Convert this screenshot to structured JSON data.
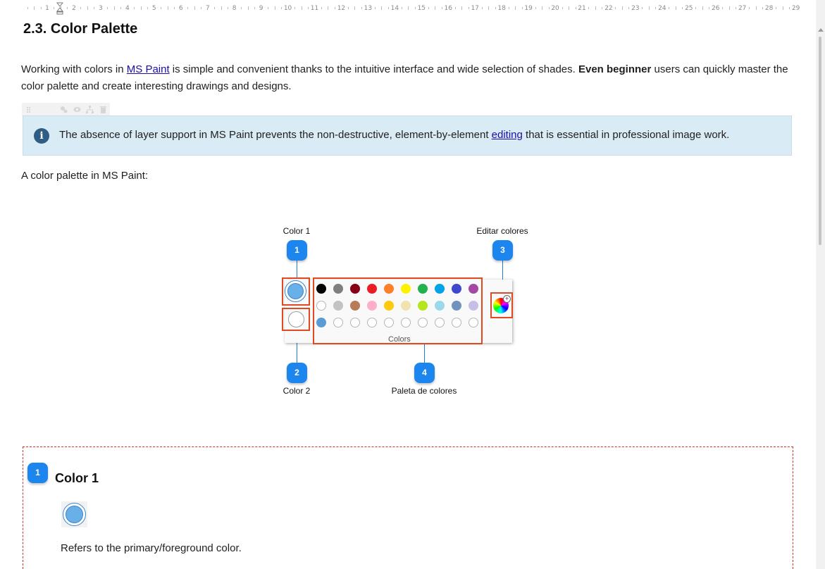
{
  "ruler": {
    "numbers": [
      "1",
      "2",
      "3",
      "4",
      "5",
      "6",
      "7",
      "8",
      "9",
      "10",
      "11",
      "12",
      "13",
      "14",
      "15",
      "16",
      "17",
      "18",
      "19",
      "20",
      "21",
      "22",
      "23",
      "24",
      "25",
      "26",
      "27",
      "28",
      "29"
    ]
  },
  "section": {
    "heading": "2.3. Color Palette",
    "intro_before_link": "Working with colors in ",
    "intro_link": "MS Paint",
    "intro_mid": " is simple and convenient thanks to the intuitive interface and wide selection of shades. ",
    "intro_bold": "Even beginner",
    "intro_after": " users can quickly master the color palette and create interesting drawings and designs."
  },
  "toolbar_icons": [
    "drag-handle-icon",
    "settings-icon",
    "visibility-icon",
    "hierarchy-icon",
    "delete-icon"
  ],
  "note": {
    "icon": "info-icon",
    "text_before_link": "The absence of layer support in MS Paint prevents the non-destructive, element-by-element ",
    "link": "editing",
    "text_after": " that is essential in professional image work."
  },
  "caption": "A color palette in MS Paint:",
  "figure": {
    "labels": {
      "color1": "Color 1",
      "color2": "Color 2",
      "edit_colors": "Editar colores",
      "palette": "Paleta de colores"
    },
    "badges": [
      "1",
      "2",
      "3",
      "4"
    ],
    "colors_label": "Colors",
    "row1": [
      "#000000",
      "#7f7f7f",
      "#880015",
      "#ed1c24",
      "#ff7f27",
      "#fff200",
      "#22b14c",
      "#00a2e8",
      "#3f48cc",
      "#a349a4"
    ],
    "row2": [
      "#ffffff",
      "#c3c3c3",
      "#b97a57",
      "#ffaec9",
      "#ffc90e",
      "#efe4b0",
      "#b5e61d",
      "#99d9ea",
      "#7092be",
      "#c8bfe7"
    ],
    "row3": [
      "#5b9bd5",
      "",
      "",
      "",
      "",
      "",
      "",
      "",
      "",
      ""
    ],
    "accent": "#e04a22",
    "badge_color": "#1d85ee"
  },
  "callout": {
    "badge": "1",
    "title": "Color 1",
    "description": "Refers to the primary/foreground color."
  }
}
